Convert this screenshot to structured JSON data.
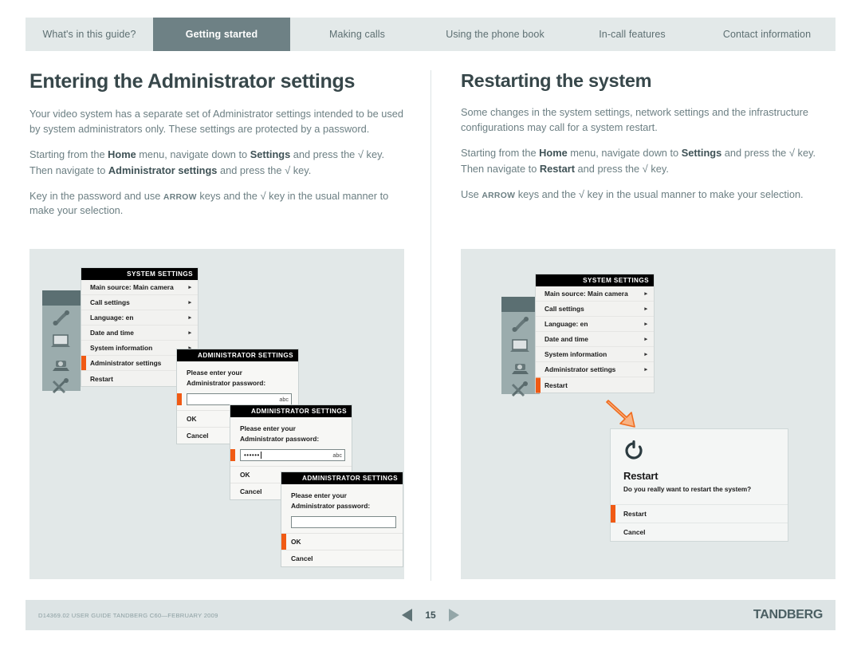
{
  "tabs": [
    {
      "label": "What's in this guide?",
      "active": false
    },
    {
      "label": "Getting started",
      "active": true
    },
    {
      "label": "Making calls",
      "active": false
    },
    {
      "label": "Using the phone book",
      "active": false
    },
    {
      "label": "In-call features",
      "active": false
    },
    {
      "label": "Contact information",
      "active": false
    }
  ],
  "left_column": {
    "heading": "Entering the Administrator settings",
    "p1": "Your video system has a separate set of Administrator settings intended to be used by system administrators only. These settings are protected by a password.",
    "p2_a": "Starting from the ",
    "p2_b1": "Home",
    "p2_c": " menu, navigate down to ",
    "p2_b2": "Settings",
    "p2_d": " and press the ",
    "p2_check": "√",
    "p2_e": " key. Then navigate to ",
    "p2_b3": "Administrator settings",
    "p2_f": " and press the ",
    "p2_check2": "√",
    "p2_g": " key.",
    "p3_a": "Key in the password and use ",
    "p3_sc": "ARROW",
    "p3_b": " keys and the ",
    "p3_check": "√",
    "p3_c": " key in the usual manner to make your selection."
  },
  "right_column": {
    "heading": "Restarting the system",
    "p1": "Some changes in the system settings, network settings and the infrastructure configurations may call for a system restart.",
    "p2_a": "Starting from the ",
    "p2_b1": "Home",
    "p2_c": " menu, navigate down to ",
    "p2_b2": "Settings",
    "p2_d": " and press the ",
    "p2_check": "√",
    "p2_e": " key. Then navigate to ",
    "p2_b3": "Restart",
    "p2_f": " and press the ",
    "p2_check2": "√",
    "p2_g": " key.",
    "p3_a": "Use ",
    "p3_sc": "ARROW",
    "p3_b": " keys and the ",
    "p3_check": "√",
    "p3_c": " key in the usual manner to make your selection."
  },
  "system_menu": {
    "title": "SYSTEM SETTINGS",
    "items": [
      {
        "label": "Main source: Main camera",
        "arrow": "▸"
      },
      {
        "label": "Call settings",
        "arrow": "▸"
      },
      {
        "label": "Language: en",
        "arrow": "▸"
      },
      {
        "label": "Date and time",
        "arrow": "▸"
      },
      {
        "label": "System information",
        "arrow": "▸"
      },
      {
        "label": "Administrator settings",
        "arrow": "▸"
      },
      {
        "label": "Restart",
        "arrow": ""
      }
    ],
    "left_selected_index": 5,
    "right_selected_index": 6
  },
  "admin_dialogs": {
    "title": "ADMINISTRATOR SETTINGS",
    "prompt_line1": "Please enter your",
    "prompt_line2": "Administrator password:",
    "input_mode": "abc",
    "ok_label": "OK",
    "cancel_label": "Cancel",
    "dialog1_value": "",
    "dialog2_value": "••••••",
    "dialog3_value": "",
    "dialog1_selected": "field",
    "dialog2_selected": "field",
    "dialog3_selected": "ok"
  },
  "restart_card": {
    "icon": "restart-power-icon",
    "title": "Restart",
    "question": "Do you really want to restart the system?",
    "restart_label": "Restart",
    "cancel_label": "Cancel",
    "selected": "restart"
  },
  "device_icons": [
    "phone-handset-icon",
    "laptop-icon",
    "camera-icon",
    "tools-icon"
  ],
  "footer": {
    "doc_id": "D14369.02 USER GUIDE TANDBERG C60—FEBRUARY 2009",
    "page_number": "15",
    "prev_icon": "prev-page-triangle-icon",
    "next_icon": "next-page-triangle-icon",
    "brand": "TANDBERG"
  },
  "colors": {
    "accent_orange": "#f05a14",
    "tab_active": "#6e8185",
    "tab_bar": "#e3e9e9",
    "panel_bg": "#e2e8e8",
    "heading": "#37474a",
    "body_text": "#6c7f83",
    "footer_bg": "#dde4e5"
  }
}
